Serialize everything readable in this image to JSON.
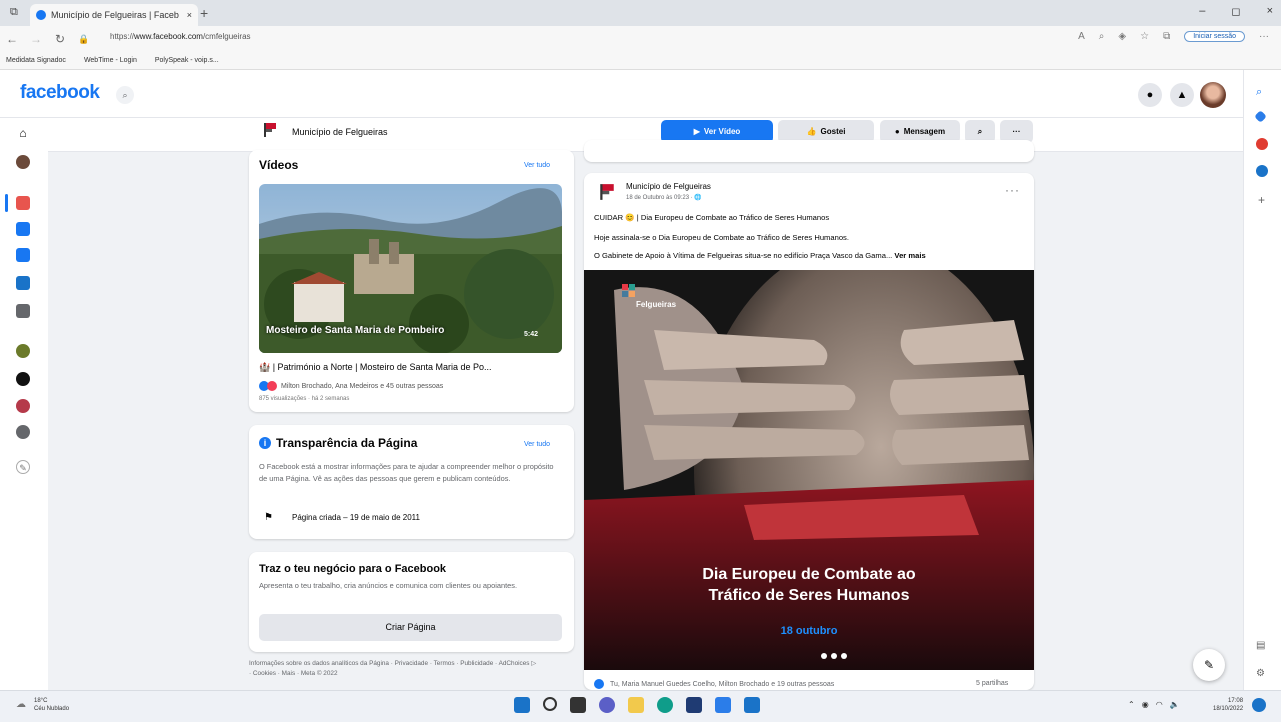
{
  "browser": {
    "tab_title": "Município de Felgueiras | Faceb",
    "close_tab": "×",
    "new_tab": "+",
    "window_controls": [
      "–",
      "◻",
      "×"
    ],
    "url_prefix": "https://",
    "url_domain": "www.facebook.com",
    "url_path": "/cmfelgueiras",
    "sign_in": "Iniciar sessão",
    "bookmarks": [
      "Medidata Signadoc",
      "WebTime - Login",
      "PolySpeak - voip.s..."
    ]
  },
  "facebook": {
    "logo": "facebook",
    "page_name": "Município de Felgueiras",
    "buttons": {
      "video": "Ver Vídeo",
      "like": "Gostei",
      "message": "Mensagem",
      "more": "···"
    }
  },
  "videos": {
    "title": "Vídeos",
    "see_all": "Ver tudo",
    "thumb_caption": "Mosteiro de Santa Maria de Pombeiro",
    "duration": "5:42",
    "video_title": "🏰 | Património a Norte | Mosteiro de Santa Maria de Po...",
    "reactions": "Milton Brochado, Ana Medeiros e 45 outras pessoas",
    "views": "875 visualizações · há 2 semanas"
  },
  "transparency": {
    "title": "Transparência da Página",
    "see_all": "Ver tudo",
    "text": "O Facebook está a mostrar informações para te ajudar a compreender melhor o propósito de uma Página. Vê as ações das pessoas que gerem e publicam conteúdos.",
    "created": "Página criada – 19 de maio de 2011"
  },
  "business": {
    "title": "Traz o teu negócio para o Facebook",
    "text": "Apresenta o teu trabalho, cria anúncios e comunica com clientes ou apoiantes.",
    "button": "Criar Página"
  },
  "footer": "Informações sobre os dados analíticos da Página · Privacidade · Termos · Publicidade · AdChoices ▷ · Cookies · Mais · Meta © 2022",
  "post": {
    "author": "Município de Felgueiras",
    "date": "18 de Outubro às 09:23 · 🌐",
    "more": "···",
    "line1": "CUIDAR 😊 | Dia Europeu de Combate ao Tráfico de Seres Humanos",
    "line2": "Hoje assinala-se o Dia Europeu de Combate ao Tráfico de Seres Humanos.",
    "line3": "O Gabinete de Apoio à Vítima de Felgueiras situa-se no edifício Praça Vasco da Gama...",
    "see_more": "Ver mais",
    "image_logo": "Felgueiras",
    "image_title_1": "Dia Europeu de Combate ao",
    "image_title_2": "Tráfico de Seres Humanos",
    "image_date": "18 outubro",
    "reactions": "Tu, Maria Manuel Guedes Coelho, Milton Brochado e 19 outras pessoas",
    "shares": "5 partilhas"
  },
  "taskbar": {
    "temp": "18°C",
    "weather": "Céu Nublado",
    "time": "17:08",
    "date": "18/10/2022"
  },
  "colors": {
    "fb_blue": "#1877f2",
    "page_bg": "#f0f2f5"
  }
}
